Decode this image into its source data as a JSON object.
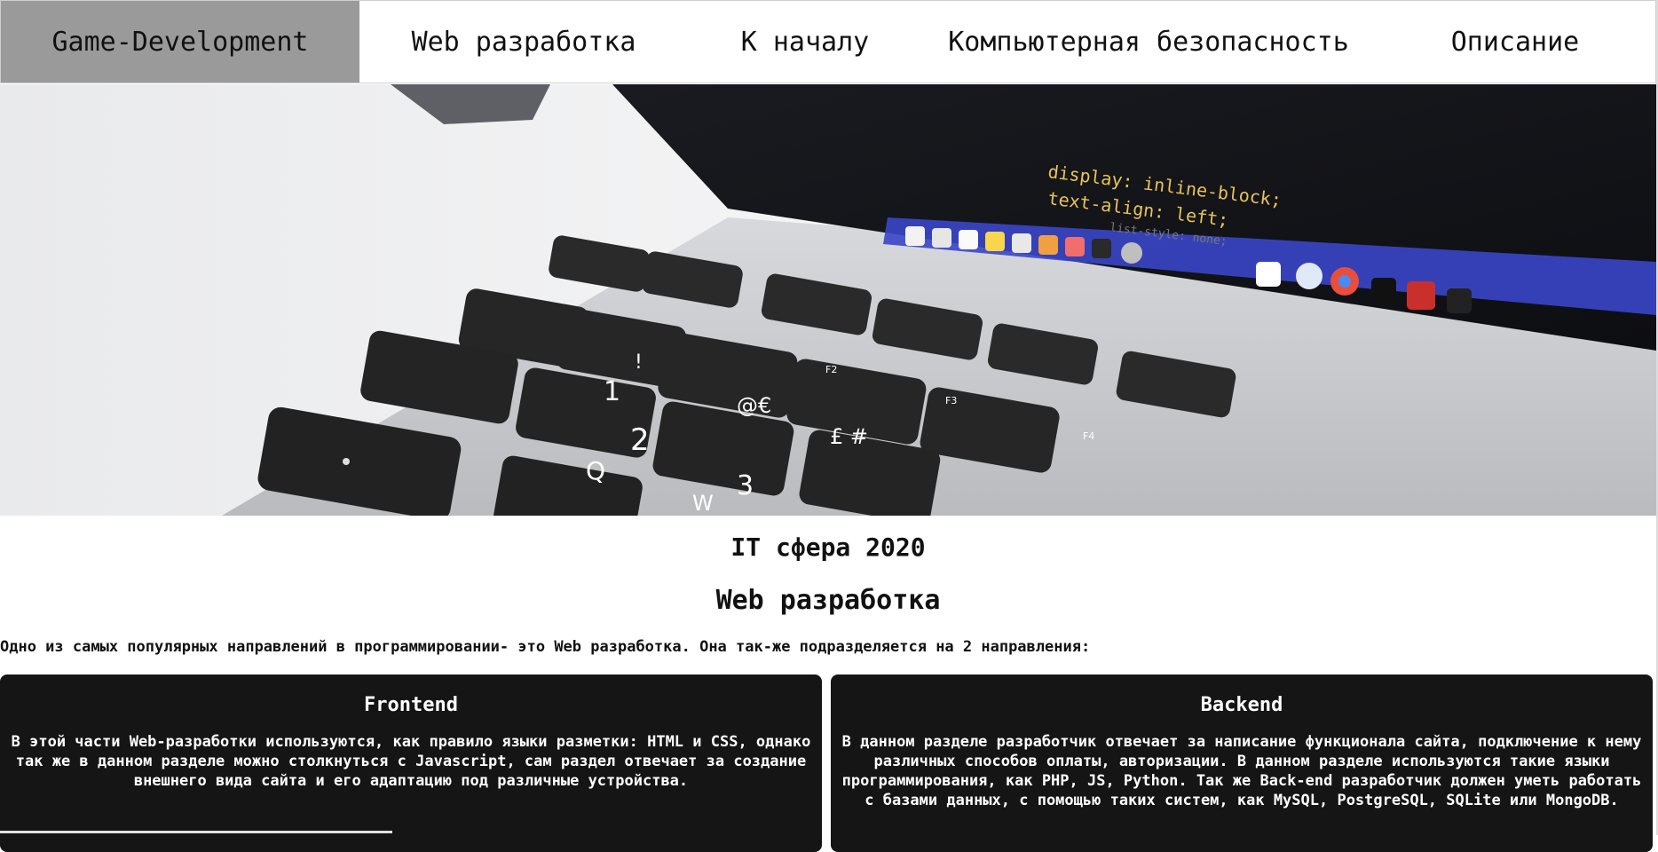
{
  "nav": {
    "items": [
      {
        "label": "Game-Development",
        "active": true
      },
      {
        "label": "Web разработка",
        "active": false
      },
      {
        "label": "К началу",
        "active": false
      },
      {
        "label": "Компьютерная безопасность",
        "active": false
      },
      {
        "label": "Описание",
        "active": false
      }
    ]
  },
  "hero": {
    "code_line_1": "display: inline-block;",
    "code_line_2": "text-align: left;",
    "key_1": "1",
    "key_2": "2",
    "key_3": "3",
    "key_q": "Q",
    "key_w": "W",
    "key_at": "@€",
    "key_pound": "£ #",
    "key_excl": "!",
    "key_f2": "F2",
    "key_f3": "F3",
    "key_f4": "F4"
  },
  "content": {
    "heading": "IT сфера 2020",
    "subheading": "Web разработка",
    "intro": "Одно из самых популярных направлений в программировании- это Web разработка. Она так-же подразделяется на 2 направления:"
  },
  "cards": {
    "frontend": {
      "title": "Frontend",
      "text": "В этой части Web-разработки используются, как правило языки разметки: HTML и CSS, однако так же в данном разделе можно столкнуться с Javascript, сам раздел отвечает за создание внешнего вида сайта и его адаптацию под различные устройства."
    },
    "backend": {
      "title": "Backend",
      "text": "В данном разделе разработчик отвечает за написание функционала сайта, подключение к нему различных способов оплаты, авторизации. В данном разделе используются такие языки программирования, как PHP, JS, Python. Так же Back-end разработчик должен уметь работать с базами данных, с помощью таких систем, как MySQL, PostgreSQL, SQLite или MongoDB."
    }
  },
  "colors": {
    "nav_active": "#9a9a9a",
    "card_bg": "#151515",
    "keyboard_key": "#2a2a2a",
    "code_yellow": "#e8c35a",
    "code_pink": "#c964c4"
  }
}
